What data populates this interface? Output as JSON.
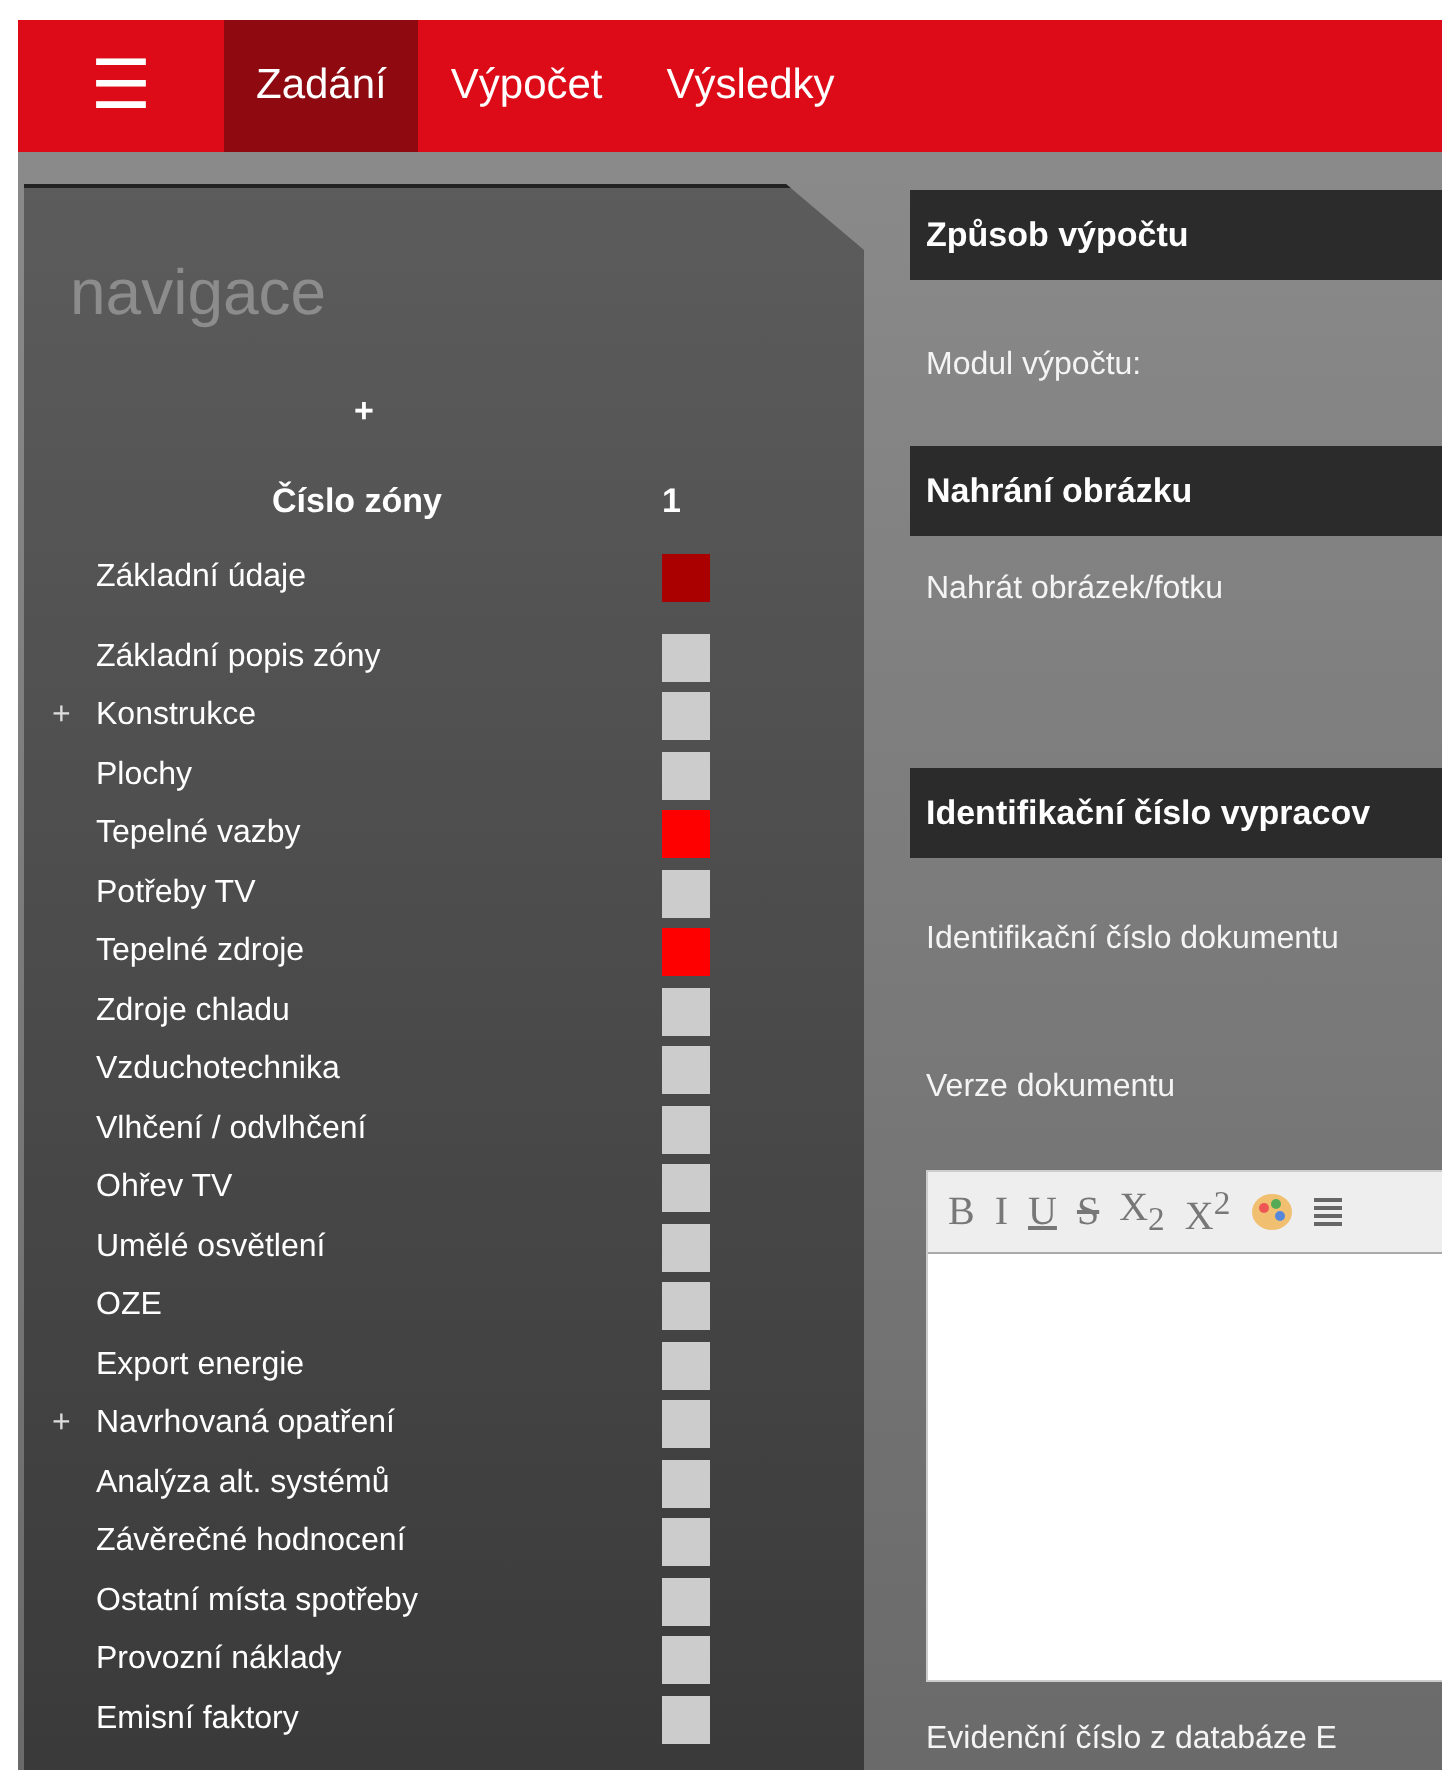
{
  "menu": {
    "icon": "☰"
  },
  "tabs": [
    {
      "label": "Zadání",
      "selected": true
    },
    {
      "label": "Výpočet",
      "selected": false
    },
    {
      "label": "Výsledky",
      "selected": false
    }
  ],
  "sidebar": {
    "title": "navigace",
    "add": "+",
    "zone_header": {
      "label": "Číslo zóny",
      "value": "1"
    },
    "items": [
      {
        "label": "Základní údaje",
        "color": "#aa0000"
      },
      {
        "label": "Základní popis zóny",
        "color": "#cccccc"
      },
      {
        "label": "Konstrukce",
        "expander": "+",
        "color": "#cccccc"
      },
      {
        "label": "Plochy",
        "color": "#cccccc"
      },
      {
        "label": "Tepelné vazby",
        "color": "#ff0000"
      },
      {
        "label": "Potřeby TV",
        "color": "#cccccc"
      },
      {
        "label": "Tepelné zdroje",
        "color": "#ff0000"
      },
      {
        "label": "Zdroje chladu",
        "color": "#cccccc"
      },
      {
        "label": "Vzduchotechnika",
        "color": "#cccccc"
      },
      {
        "label": "Vlhčení / odvlhčení",
        "color": "#cccccc"
      },
      {
        "label": "Ohřev TV",
        "color": "#cccccc"
      },
      {
        "label": "Umělé osvětlení",
        "color": "#cccccc"
      },
      {
        "label": "OZE",
        "color": "#cccccc"
      },
      {
        "label": "Export energie",
        "color": "#cccccc"
      },
      {
        "label": "Navrhovaná opatření",
        "expander": "+",
        "color": "#cccccc"
      },
      {
        "label": "Analýza alt. systémů",
        "color": "#cccccc"
      },
      {
        "label": "Závěrečné hodnocení",
        "color": "#cccccc"
      },
      {
        "label": "Ostatní místa spotřeby",
        "color": "#cccccc"
      },
      {
        "label": "Provozní náklady",
        "color": "#cccccc"
      },
      {
        "label": "Emisní faktory",
        "color": "#cccccc"
      }
    ]
  },
  "sections": [
    {
      "title": "Způsob výpočtu",
      "fields": [
        {
          "kind": "label",
          "label": "Modul výpočtu:"
        }
      ]
    },
    {
      "title": "Nahrání obrázku",
      "fields": [
        {
          "kind": "label",
          "label": "Nahrát obrázek/fotku"
        }
      ]
    },
    {
      "title": "Identifikační číslo vypracov",
      "fields": [
        {
          "kind": "label",
          "label": "Identifikační číslo dokumentu"
        },
        {
          "kind": "label",
          "label": "Verze dokumentu"
        },
        {
          "kind": "editor",
          "toolbar": [
            {
              "kind": "bold",
              "label": "B"
            },
            {
              "kind": "italic",
              "label": "I"
            },
            {
              "kind": "underline",
              "label": "U"
            },
            {
              "kind": "strike",
              "label": "S"
            },
            {
              "kind": "text",
              "label": "X$_{2}$"
            },
            {
              "kind": "text",
              "label": "X$^{2}$"
            },
            {
              "kind": "palette"
            },
            {
              "kind": "align"
            }
          ]
        },
        {
          "kind": "label",
          "label": "Evidenční číslo z databáze E"
        }
      ]
    }
  ]
}
